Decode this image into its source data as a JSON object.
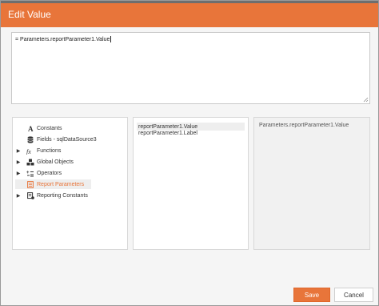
{
  "dialog": {
    "title": "Edit Value"
  },
  "expression": {
    "value": "= Parameters.reportParameter1.Value"
  },
  "tree": {
    "items": [
      {
        "label": "Constants",
        "icon": "constants-icon",
        "expandable": false
      },
      {
        "label": "Fields - sqlDataSource3",
        "icon": "database-icon",
        "expandable": false
      },
      {
        "label": "Functions",
        "icon": "function-icon",
        "expandable": true
      },
      {
        "label": "Global Objects",
        "icon": "objects-icon",
        "expandable": true
      },
      {
        "label": "Operators",
        "icon": "operators-icon",
        "expandable": true
      },
      {
        "label": "Report Parameters",
        "icon": "report-parameters-icon",
        "expandable": false,
        "selected": true
      },
      {
        "label": "Reporting Constants",
        "icon": "reporting-constants-icon",
        "expandable": true
      }
    ]
  },
  "fields": {
    "items": [
      {
        "label": "reportParameter1.Value"
      },
      {
        "label": "reportParameter1.Label"
      }
    ]
  },
  "description": {
    "text": "Parameters.reportParameter1.Value"
  },
  "buttons": {
    "save_label": "Save",
    "cancel_label": "Cancel"
  },
  "colors": {
    "accent": "#e8753a",
    "title_text": "#ffffff"
  }
}
